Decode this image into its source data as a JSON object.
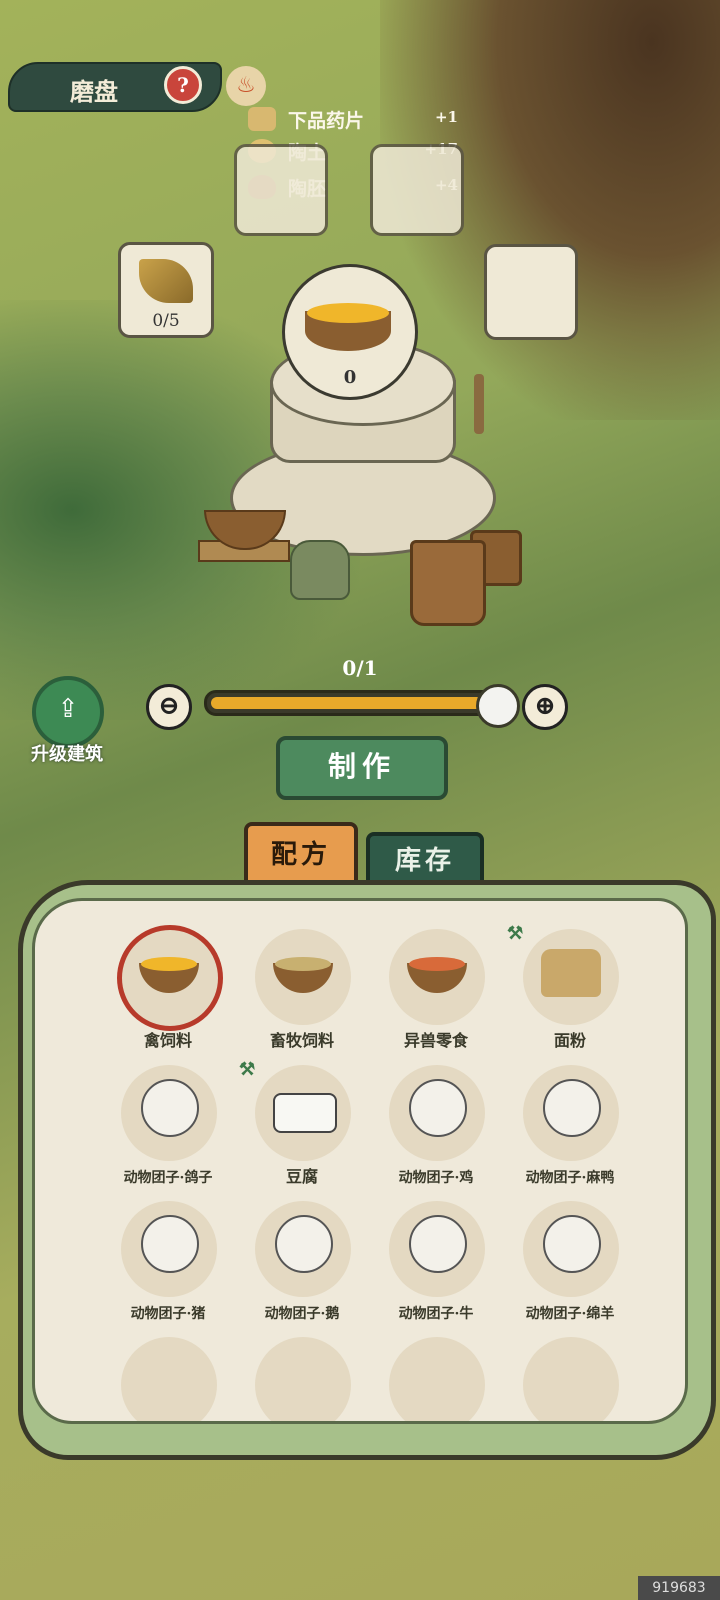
{
  "header": {
    "title": "磨盘",
    "help_icon": "?"
  },
  "resources": [
    {
      "name": "下品药片",
      "count": "+1"
    },
    {
      "name": "陶土",
      "count": "+17"
    },
    {
      "name": "陶胚",
      "count": "+4"
    }
  ],
  "slots": {
    "input_count": "0/5",
    "output_count": "0"
  },
  "quantity": {
    "label": "0/1",
    "value": 1,
    "max": 1
  },
  "controls": {
    "minus": "⊖",
    "plus": "⊕",
    "upgrade_label": "升级建筑",
    "make_button": "制作"
  },
  "tabs": {
    "recipe": "配方",
    "stock": "库存"
  },
  "recipes": [
    {
      "label": "禽饲料",
      "art": "bowl-grain",
      "selected": true
    },
    {
      "label": "畜牧饲料",
      "art": "bowl-feed"
    },
    {
      "label": "异兽零食",
      "art": "bowl-snack"
    },
    {
      "label": "面粉",
      "art": "sack",
      "locked_hammer": true
    },
    {
      "label": "动物团子·鸽子",
      "art": "ball"
    },
    {
      "label": "豆腐",
      "art": "tofu",
      "locked_hammer": true
    },
    {
      "label": "动物团子·鸡",
      "art": "ball"
    },
    {
      "label": "动物团子·麻鸭",
      "art": "ball"
    },
    {
      "label": "动物团子·猪",
      "art": "ball"
    },
    {
      "label": "动物团子·鹅",
      "art": "ball"
    },
    {
      "label": "动物团子·牛",
      "art": "ball"
    },
    {
      "label": "动物团子·绵羊",
      "art": "ball"
    }
  ],
  "watermark": "919683",
  "colors": {
    "accent_orange": "#e79c4e",
    "button_green": "#4d8a5e",
    "selected_ring": "#b73a2a",
    "slider_fill": "#e8a92a"
  }
}
